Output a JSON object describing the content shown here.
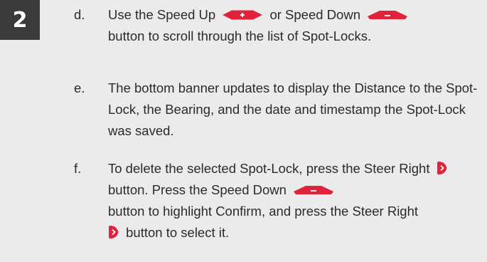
{
  "step_number": "2",
  "items": [
    {
      "marker": "d.",
      "parts": [
        "Use the Speed Up",
        "or Speed Down",
        "button to scroll through the list of Spot-Locks."
      ]
    },
    {
      "marker": "e.",
      "text": "The bottom banner updates to display the Distance to the Spot-Lock, the Bearing, and the date and timestamp the Spot-Lock was saved."
    },
    {
      "marker": "f.",
      "parts": [
        "To delete the selected Spot-Lock, press the Steer Right",
        "button. Press the Speed Down",
        "button to highlight Confirm, and press the Steer Right",
        "button to select it."
      ]
    }
  ],
  "icons": {
    "speed_up": "speed-up-icon",
    "speed_down": "speed-down-icon",
    "steer_right": "steer-right-icon"
  },
  "colors": {
    "background": "#ebebeb",
    "badge": "#3a3a3a",
    "text": "#2b2b2b",
    "icon_red": "#e0223a"
  }
}
